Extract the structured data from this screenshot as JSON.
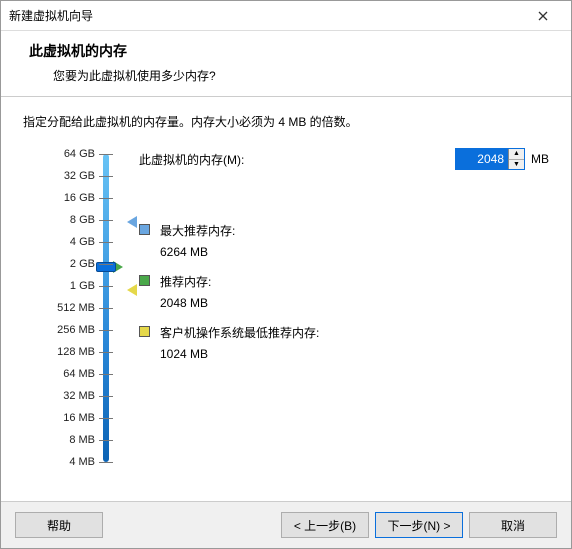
{
  "window": {
    "title": "新建虚拟机向导"
  },
  "header": {
    "heading": "此虚拟机的内存",
    "sub": "您要为此虚拟机使用多少内存?"
  },
  "instruction": "指定分配给此虚拟机的内存量。内存大小必须为 4 MB 的倍数。",
  "memory": {
    "label": "此虚拟机的内存(M):",
    "value": "2048",
    "unit": "MB"
  },
  "hints": {
    "max": {
      "label": "最大推荐内存:",
      "value": "6264 MB",
      "color": "#6aa6e0"
    },
    "rec": {
      "label": "推荐内存:",
      "value": "2048 MB",
      "color": "#4aa84a"
    },
    "min": {
      "label": "客户机操作系统最低推荐内存:",
      "value": "1024 MB",
      "color": "#e5d84a"
    }
  },
  "scale": {
    "ticks": [
      "64 GB",
      "32 GB",
      "16 GB",
      "8 GB",
      "4 GB",
      "2 GB",
      "1 GB",
      "512 MB",
      "256 MB",
      "128 MB",
      "64 MB",
      "32 MB",
      "16 MB",
      "8 MB",
      "4 MB"
    ]
  },
  "buttons": {
    "help": "帮助",
    "back": "< 上一步(B)",
    "next": "下一步(N) >",
    "cancel": "取消"
  }
}
